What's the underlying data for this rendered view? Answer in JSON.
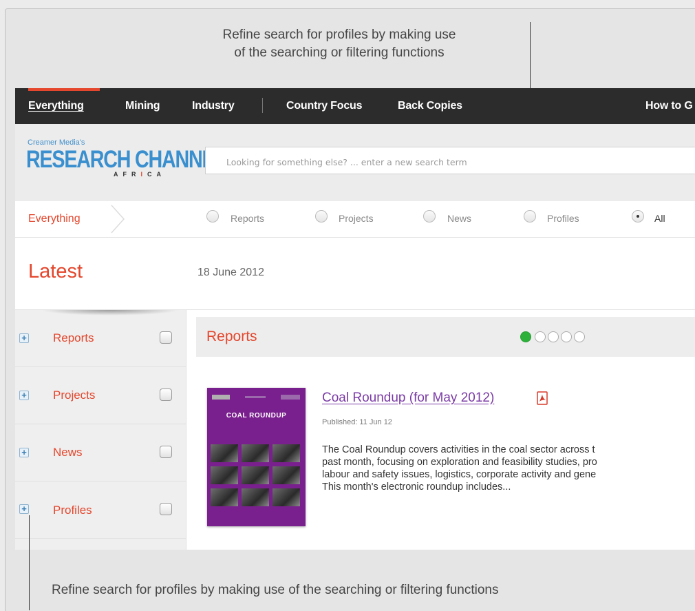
{
  "callouts": {
    "top_line1": "Refine search for profiles by making use",
    "top_line2": "of the searching or filtering functions",
    "bottom": "Refine search for profiles by making use of the searching or filtering functions"
  },
  "nav": {
    "items": [
      {
        "label": "Everything",
        "active": true
      },
      {
        "label": "Mining"
      },
      {
        "label": "Industry"
      },
      {
        "label": "Country Focus"
      },
      {
        "label": "Back Copies"
      },
      {
        "label": "How to G"
      }
    ]
  },
  "logo": {
    "small": "Creamer Media's",
    "main": "RESEARCH CHANNEL",
    "sub": "AFRICA"
  },
  "search": {
    "placeholder": "Looking for something else? ... enter a new search term"
  },
  "filter": {
    "breadcrumb": "Everything",
    "options": [
      {
        "label": "Reports",
        "selected": false
      },
      {
        "label": "Projects",
        "selected": false
      },
      {
        "label": "News",
        "selected": false
      },
      {
        "label": "Profiles",
        "selected": false
      },
      {
        "label": "All",
        "selected": true
      }
    ]
  },
  "latest": {
    "title": "Latest",
    "date": "18 June 2012"
  },
  "sidebar": {
    "items": [
      {
        "label": "Reports"
      },
      {
        "label": "Projects"
      },
      {
        "label": "News"
      },
      {
        "label": "Profiles"
      }
    ]
  },
  "content": {
    "title": "Reports",
    "pager": {
      "count": 5,
      "current": 1
    },
    "report": {
      "title": "Coal Roundup (for May 2012)",
      "published": "Published: 11 Jun 12",
      "cover_title": "COAL ROUNDUP",
      "desc_lines": [
        "The Coal Roundup covers activities in the coal sector across t",
        "past month, focusing on exploration and feasibility studies, pro",
        "labour and safety issues, logistics, corporate activity and gene",
        "This month's electronic roundup includes..."
      ]
    }
  },
  "colors": {
    "accent": "#e4472d",
    "nav_bg": "#2c2c2c",
    "logo_blue": "#3a8fcf",
    "link_purple": "#7a3aa5",
    "pager_active": "#2db13a"
  }
}
